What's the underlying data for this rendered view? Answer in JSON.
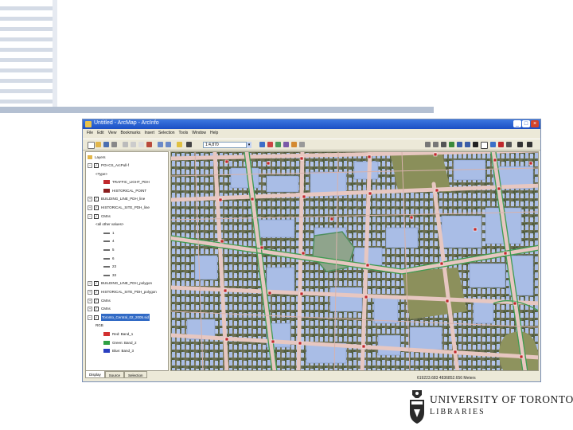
{
  "window": {
    "title": "Untitled - ArcMap - ArcInfo",
    "minimize_glyph": "_",
    "maximize_glyph": "□",
    "close_glyph": "×"
  },
  "menu": [
    "File",
    "Edit",
    "View",
    "Bookmarks",
    "Insert",
    "Selection",
    "Tools",
    "Window",
    "Help"
  ],
  "toolbar": {
    "scale_value": "1:4,870"
  },
  "toc": {
    "title": "Layers",
    "layers": [
      {
        "label": "POI-CS_ArcPull-f",
        "checked": true,
        "expanded": true,
        "level": 1
      },
      {
        "label": "<Type>",
        "level": 2
      },
      {
        "label": "TRAFFIC_LIGHT_PDH",
        "level": 3,
        "symbol": "light-icon"
      },
      {
        "label": "HISTORICAL_POINT",
        "level": 3,
        "symbol": "marker-icon"
      },
      {
        "label": "BUILDING_LINE_PDH_line",
        "checked": true,
        "expanded": false,
        "level": 1
      },
      {
        "label": "HISTORICAL_SITE_PDH_line",
        "checked": true,
        "expanded": false,
        "level": 1
      },
      {
        "label": "CMns",
        "checked": true,
        "expanded": true,
        "level": 1
      },
      {
        "label": "<all other values>",
        "level": 2
      },
      {
        "label": "1",
        "level": 3
      },
      {
        "label": "4",
        "level": 3
      },
      {
        "label": "5",
        "level": 3
      },
      {
        "label": "6",
        "level": 3
      },
      {
        "label": "23",
        "level": 3
      },
      {
        "label": "33",
        "level": 3
      },
      {
        "label": "BUILDING_LINE_PDH_polygon",
        "checked": true,
        "expanded": false,
        "level": 1
      },
      {
        "label": "HISTORICAL_SITE_PDH_polygon",
        "checked": true,
        "expanded": false,
        "level": 1
      },
      {
        "label": "CMns",
        "checked": true,
        "expanded": false,
        "level": 1
      },
      {
        "label": "CMns",
        "checked": true,
        "expanded": false,
        "level": 1
      },
      {
        "label": "Toronto_Central_02_2005.sid",
        "checked": true,
        "expanded": true,
        "level": 1,
        "selected": true
      },
      {
        "label": "RGB",
        "level": 2
      },
      {
        "label": "Red: Band_1",
        "level": 3,
        "symbol": "red-swatch"
      },
      {
        "label": "Green: Band_2",
        "level": 3,
        "symbol": "green-swatch"
      },
      {
        "label": "Blue: Band_3",
        "level": 3,
        "symbol": "blue-swatch"
      }
    ],
    "tabs": [
      "Display",
      "Source",
      "Selection"
    ]
  },
  "status": {
    "coords": "619223.683 4836852.656 Meters"
  },
  "logo": {
    "name": "UNIVERSITY OF TORONTO",
    "sub": "LIBRARIES"
  },
  "colors": {
    "titlebar": "#1b4fc4",
    "building": "#a9bde6",
    "road": "#e7c7c1",
    "green_line": "#3f9c52",
    "marker": "#c0282c"
  }
}
